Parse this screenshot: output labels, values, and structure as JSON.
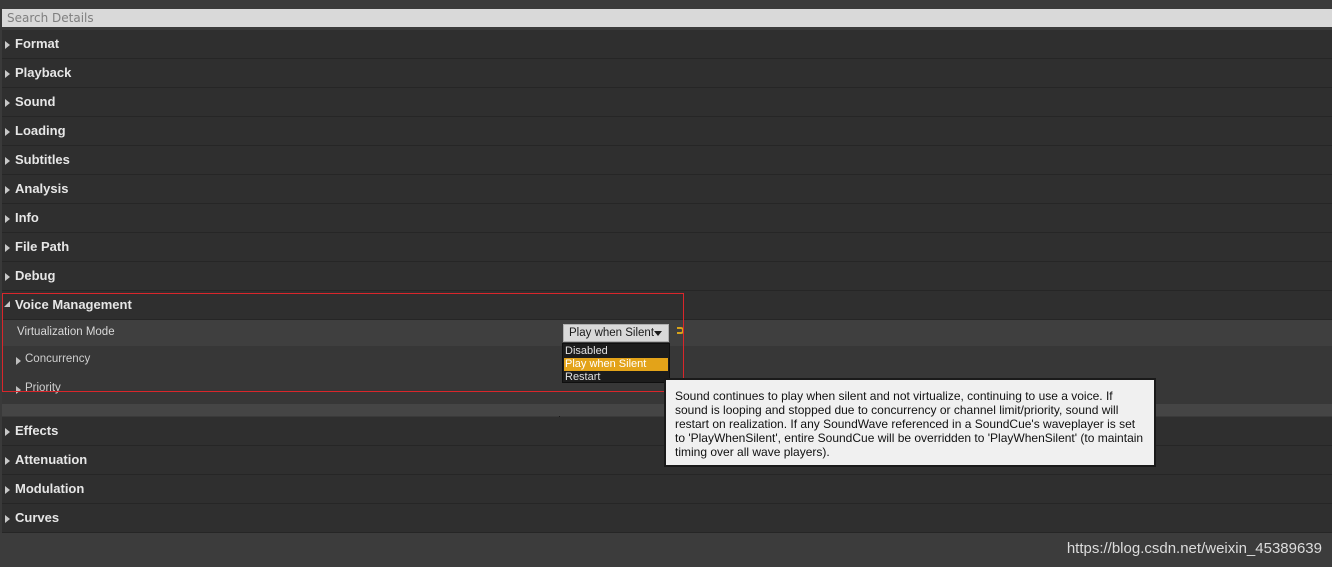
{
  "search": {
    "placeholder": "Search Details"
  },
  "categories_top": [
    {
      "label": "Format"
    },
    {
      "label": "Playback"
    },
    {
      "label": "Sound"
    },
    {
      "label": "Loading"
    },
    {
      "label": "Subtitles"
    },
    {
      "label": "Analysis"
    },
    {
      "label": "Info"
    },
    {
      "label": "File Path"
    },
    {
      "label": "Debug"
    }
  ],
  "voice_management": {
    "label": "Voice Management",
    "virtualization_mode": {
      "label": "Virtualization Mode",
      "value": "Play when Silent",
      "options": [
        "Disabled",
        "Play when Silent",
        "Restart"
      ]
    },
    "concurrency_label": "Concurrency",
    "priority_label": "Priority"
  },
  "categories_bottom": [
    {
      "label": "Effects"
    },
    {
      "label": "Attenuation"
    },
    {
      "label": "Modulation"
    },
    {
      "label": "Curves"
    }
  ],
  "tooltip": {
    "text": "Sound continues to play when silent and not virtualize, continuing to use a voice. If sound is looping and stopped due to concurrency or channel limit/priority, sound will restart on realization. If any SoundWave referenced in a SoundCue's waveplayer is set to 'PlayWhenSilent', entire SoundCue will be overridden to 'PlayWhenSilent' (to maintain timing over all wave players)."
  },
  "watermark": "https://blog.csdn.net/weixin_45389639",
  "colors": {
    "highlight_box": "#d9262b",
    "selected_option": "#e3a319",
    "background": "#3a3a3a"
  }
}
